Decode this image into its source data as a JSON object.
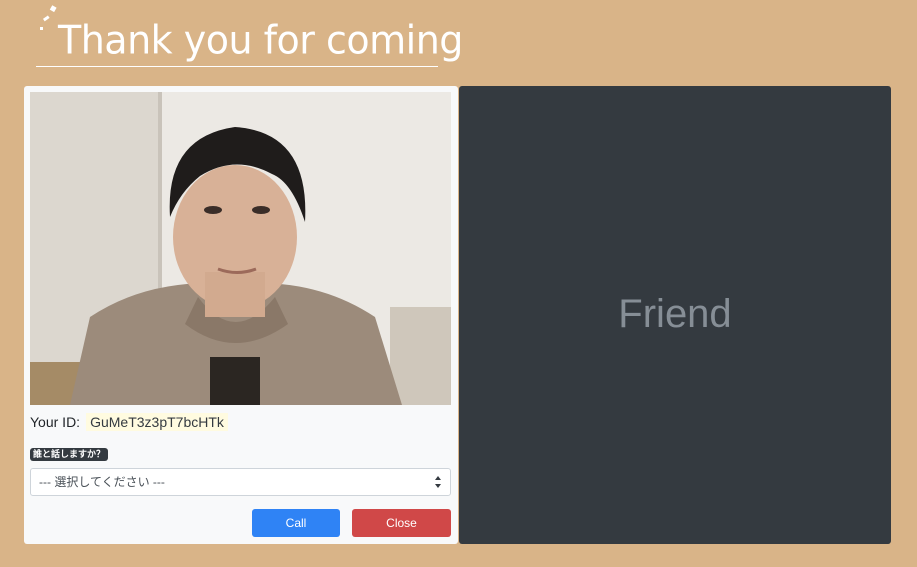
{
  "header": {
    "title": "Thank you for coming"
  },
  "local": {
    "your_id_label": "Your ID:",
    "your_id_value": "GuMeT3z3pT7bcHTk",
    "who_label": "誰と話しますか？",
    "select_placeholder": "--- 選択してください ---",
    "call_label": "Call",
    "close_label": "Close"
  },
  "remote": {
    "label": "Friend"
  },
  "colors": {
    "background": "#d9b488",
    "call_button": "#2f83f5",
    "close_button": "#d04848",
    "remote_panel": "#343a40"
  }
}
